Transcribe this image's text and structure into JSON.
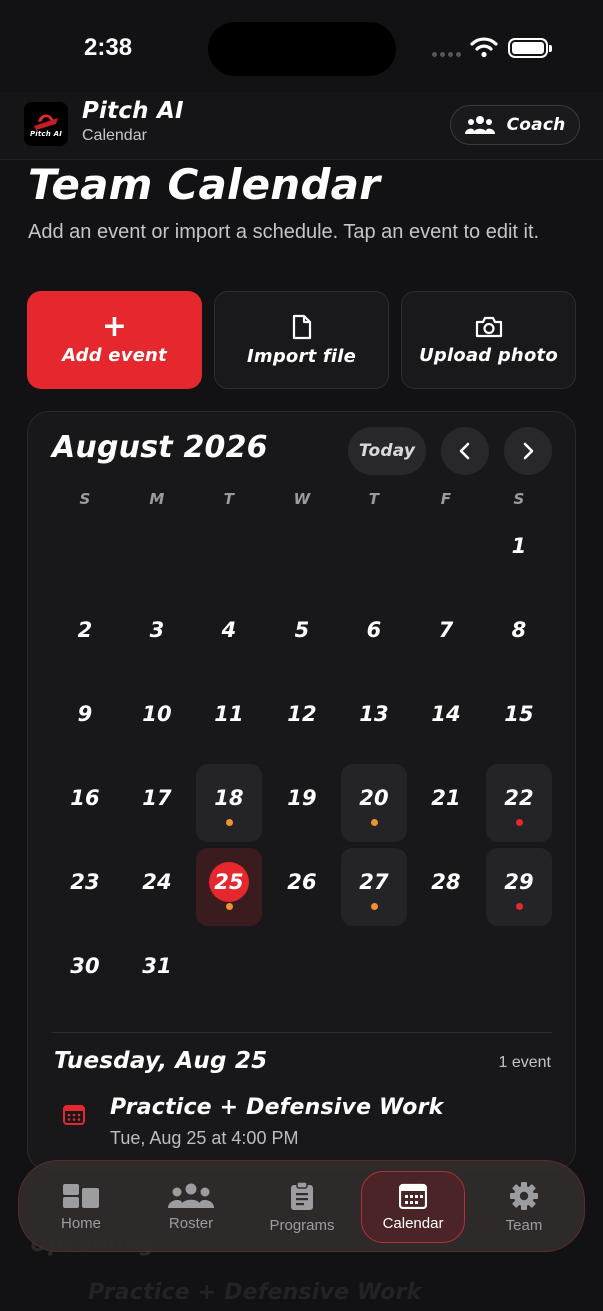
{
  "status": {
    "time": "2:38"
  },
  "header": {
    "app_name": "Pitch AI",
    "logo_text": "Pitch AI",
    "subtitle": "Calendar",
    "role_label": "Coach"
  },
  "page": {
    "title": "Team Calendar",
    "description": "Add an event or import a schedule. Tap an event to edit it."
  },
  "actions": {
    "add": "Add event",
    "import": "Import file",
    "upload": "Upload photo"
  },
  "calendar": {
    "month_label": "August 2026",
    "today_label": "Today",
    "weekdays": [
      "S",
      "M",
      "T",
      "W",
      "T",
      "F",
      "S"
    ],
    "days": [
      "1",
      "2",
      "3",
      "4",
      "5",
      "6",
      "7",
      "8",
      "9",
      "10",
      "11",
      "12",
      "13",
      "14",
      "15",
      "16",
      "17",
      "18",
      "19",
      "20",
      "21",
      "22",
      "23",
      "24",
      "25",
      "26",
      "27",
      "28",
      "29",
      "30",
      "31"
    ],
    "selected_date": "Tuesday, Aug 25",
    "event_count": "1 event",
    "event": {
      "title": "Practice + Defensive Work",
      "time": "Tue, Aug 25 at 4:00 PM"
    }
  },
  "colors": {
    "accent": "#e5282d",
    "dot_orange": "#f0932b",
    "dot_red": "#e5282d"
  },
  "ghost": {
    "line1": "Upcoming",
    "line2": "Practice + Defensive Work"
  },
  "tabs": [
    {
      "label": "Home",
      "icon": "home-dashboard-icon"
    },
    {
      "label": "Roster",
      "icon": "people-icon"
    },
    {
      "label": "Programs",
      "icon": "clipboard-icon"
    },
    {
      "label": "Calendar",
      "icon": "calendar-icon"
    },
    {
      "label": "Team",
      "icon": "gear-icon"
    }
  ]
}
